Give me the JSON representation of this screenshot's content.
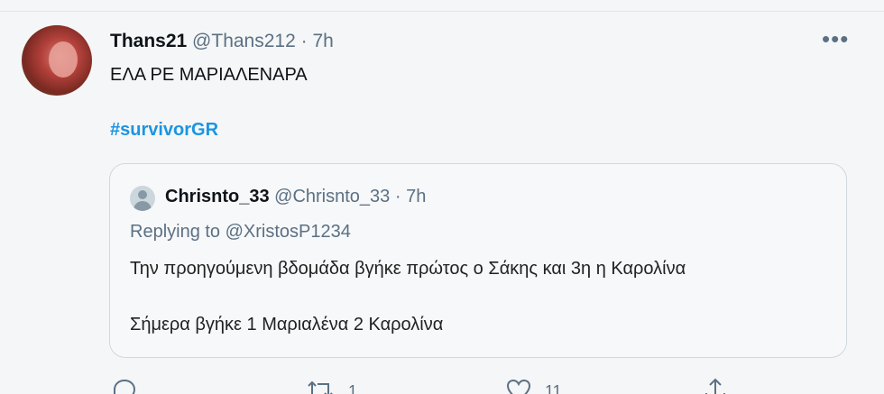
{
  "tweet": {
    "display_name": "Thans21",
    "handle": "@Thans212",
    "time": "7h",
    "text": "ΕΛΑ ΡΕ ΜΑΡΙΑΛΕΝΑΡΑ",
    "hashtag": "#survivorGR",
    "separator": "·"
  },
  "quoted": {
    "display_name": "Chrisnto_33",
    "handle": "@Chrisnto_33",
    "time": "7h",
    "replying_prefix": "Replying to",
    "replying_handle": "@XristosP1234",
    "line1": "Την προηγούμενη βδομάδα βγήκε πρώτος ο Σάκης και 3η η Καρολίνα",
    "line2": "Σήμερα βγήκε 1 Μαριαλένα 2 Καρολίνα"
  },
  "actions": {
    "reply_count": "",
    "retweet_count": "1",
    "like_count": "11"
  },
  "icons": [
    "more-icon",
    "reply-icon",
    "retweet-icon",
    "like-icon",
    "share-icon",
    "default-avatar-icon"
  ],
  "colors": {
    "hashtag": "#1b95e0",
    "muted": "#5b7083",
    "background": "#f5f6f7"
  }
}
